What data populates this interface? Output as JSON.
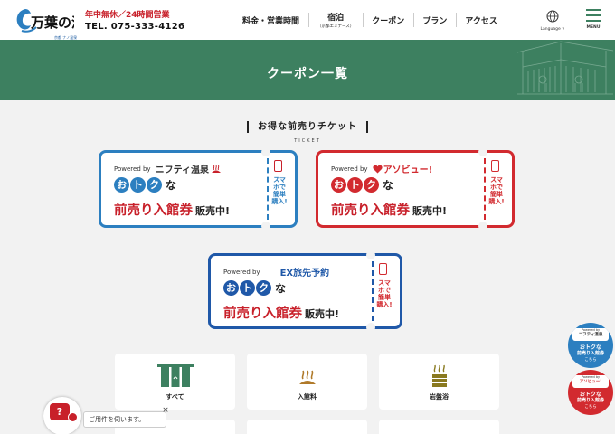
{
  "header": {
    "logo_text": "万葉の湯",
    "logo_sub": "京都 ナノ温泉",
    "open_hours": "年中無休／24時間営業",
    "tel": "TEL. 075-333-4126",
    "nav": [
      {
        "label": "料金・営業時間",
        "sub": ""
      },
      {
        "label": "宿泊",
        "sub": "（京都エミナース）"
      },
      {
        "label": "クーポン",
        "sub": ""
      },
      {
        "label": "プラン",
        "sub": ""
      },
      {
        "label": "アクセス",
        "sub": ""
      }
    ],
    "language_label": "Language",
    "menu_label": "MENU"
  },
  "banner": {
    "title": "クーポン一覧"
  },
  "section": {
    "title": "お得な前売りチケット",
    "subtitle": "TICKET"
  },
  "tickets": [
    {
      "powered": "Powered by",
      "brand": "ニフティ温泉",
      "circles": [
        "お",
        "ト",
        "ク"
      ],
      "na": "な",
      "big": "前売り入館券",
      "hanbai": "販売中!",
      "side": [
        "スマホで",
        "簡単購入!"
      ],
      "color": "#2c7fc0"
    },
    {
      "powered": "Powered by",
      "brand": "アソビュー!",
      "circles": [
        "お",
        "ト",
        "ク"
      ],
      "na": "な",
      "big": "前売り入館券",
      "hanbai": "販売中!",
      "side": [
        "スマホで",
        "簡単購入!"
      ],
      "color": "#d22a2f"
    },
    {
      "powered": "Powered by",
      "brand": "EX旅先予約",
      "circles": [
        "お",
        "ト",
        "ク"
      ],
      "na": "な",
      "big": "前売り入館券",
      "hanbai": "販売中!",
      "side": [
        "スマホで",
        "簡単購入!"
      ],
      "color": "#1f58a8"
    }
  ],
  "categories": [
    {
      "label": "すべて",
      "icon": "noren-icon"
    },
    {
      "label": "入館料",
      "icon": "hot-spring-icon"
    },
    {
      "label": "岩盤浴",
      "icon": "stone-bath-icon"
    }
  ],
  "chat": {
    "bubble": "ご用件を伺います。",
    "close": "×"
  },
  "float_badges": [
    {
      "powered": "Powered by",
      "brand": "ニフティ温泉",
      "l1": "おトクな",
      "l2": "前売り入館券",
      "l3": "こちら",
      "color": "#2c7fc0"
    },
    {
      "powered": "Powered by",
      "brand": "アソビュー!",
      "l1": "おトクな",
      "l2": "前売り入館券",
      "l3": "こちら",
      "color": "#d22a2f"
    }
  ],
  "colors": {
    "accent_green": "#3d8060",
    "red": "#c8202a"
  }
}
